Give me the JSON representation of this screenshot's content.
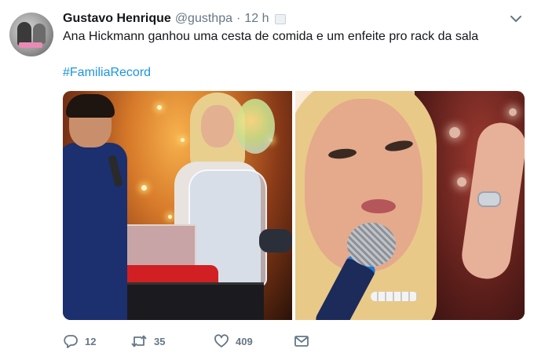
{
  "tweet": {
    "display_name": "Gustavo Henrique",
    "handle": "@gusthpa",
    "separator": "·",
    "time": "12 h",
    "text": "Ana Hickmann ganhou uma cesta de comida e um enfeite pro rack da sala",
    "hashtag": "#FamiliaRecord"
  },
  "media": {
    "photos": [
      {
        "subject": "tv-studio-gift-basket"
      },
      {
        "subject": "tv-closeup-with-microphone"
      }
    ]
  },
  "actions": {
    "reply": {
      "icon": "reply-icon",
      "count": "12"
    },
    "retweet": {
      "icon": "retweet-icon",
      "count": "35"
    },
    "like": {
      "icon": "heart-icon",
      "count": "409"
    },
    "message": {
      "icon": "envelope-icon"
    }
  },
  "colors": {
    "text_primary": "#14171a",
    "text_secondary": "#657786",
    "link": "#1b95e0",
    "background": "#ffffff"
  }
}
